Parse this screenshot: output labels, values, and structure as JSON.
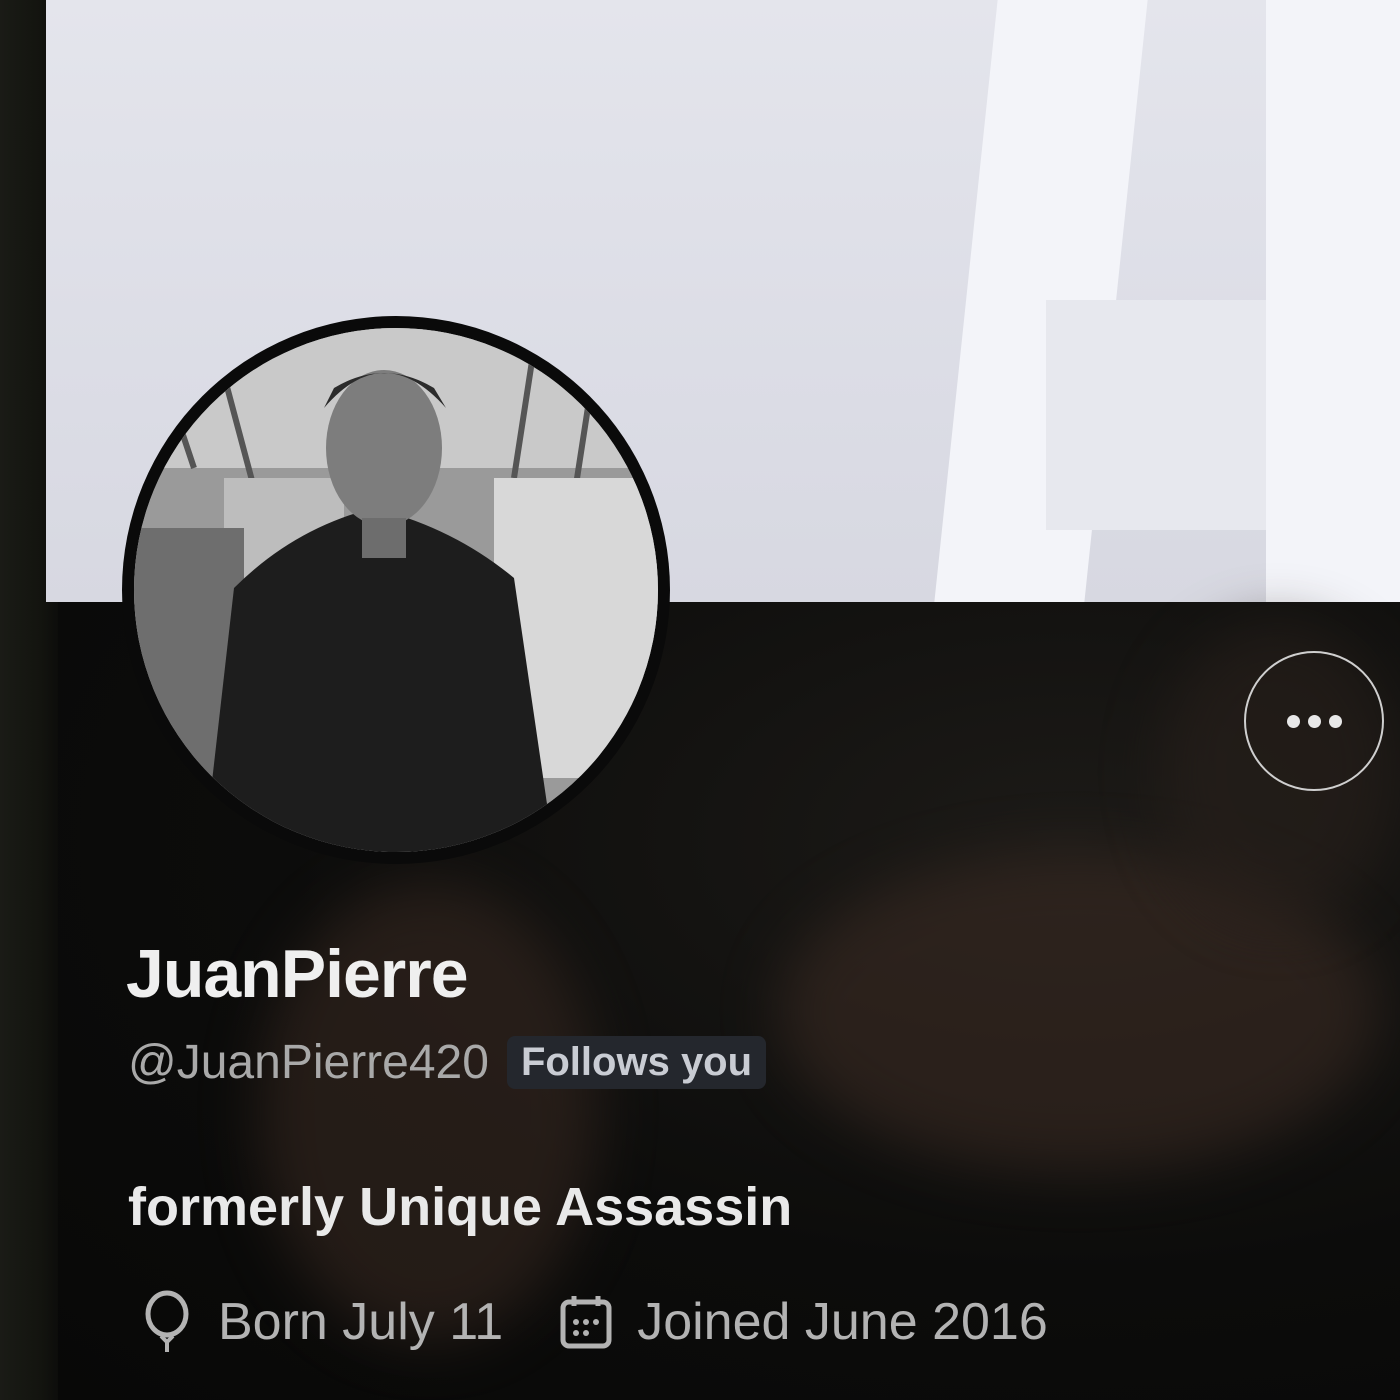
{
  "profile": {
    "display_name": "JuanPierre",
    "handle": "@JuanPierre420",
    "follows_you_label": "Follows you",
    "bio": "formerly Unique Assassin",
    "birthday": "Born July 11",
    "joined": "Joined June 2016"
  },
  "icons": {
    "more": "more-horizontal-icon",
    "birthday": "balloon-icon",
    "joined": "calendar-icon"
  },
  "colors": {
    "background": "#090908",
    "banner": "#dcdde6",
    "text_primary": "#efefef",
    "text_secondary": "#a9a9a9",
    "badge_background": "#24272d"
  }
}
